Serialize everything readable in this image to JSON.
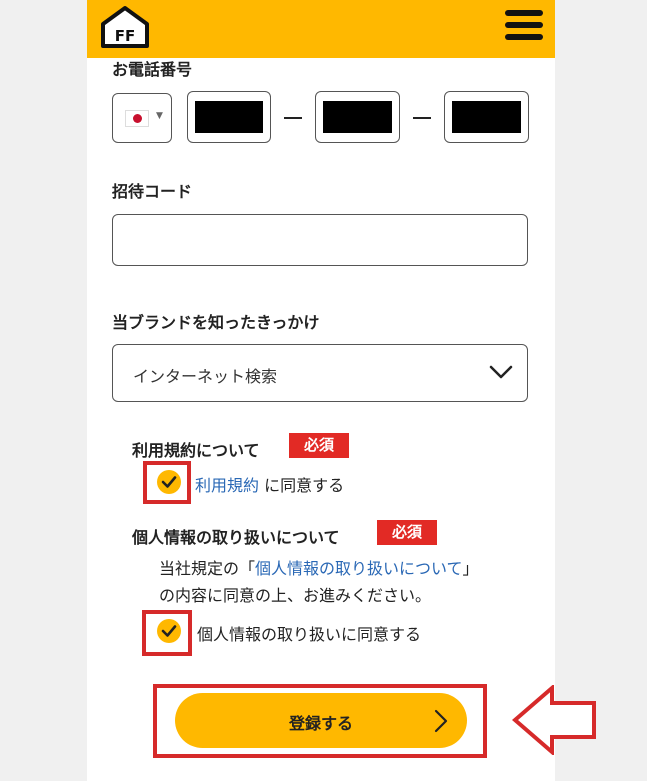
{
  "header": {
    "logo_text": "FF",
    "menu_icon": "hamburger-icon",
    "brand_color": "#ffb800"
  },
  "phone": {
    "label": "お電話番号",
    "country_flag": "japan-flag-icon"
  },
  "invite": {
    "label": "招待コード",
    "value": ""
  },
  "referral": {
    "label": "当ブランドを知ったきっかけ",
    "selected": "インターネット検索"
  },
  "terms": {
    "title": "利用規約について",
    "required": "必須",
    "link": "利用規約",
    "agree_suffix": " に同意する"
  },
  "privacy": {
    "title": "個人情報の取り扱いについて",
    "required": "必須",
    "prefix": "当社規定の「",
    "link": "個人情報の取り扱いについて",
    "suffix": "」",
    "line2": "の内容に同意の上、お進みください。",
    "agree": "個人情報の取り扱いに同意する"
  },
  "submit": {
    "label": "登録する"
  },
  "colors": {
    "accent": "#ffb800",
    "required_badge": "#e22a25",
    "highlight": "#d62a2a",
    "link": "#2a68b5"
  }
}
